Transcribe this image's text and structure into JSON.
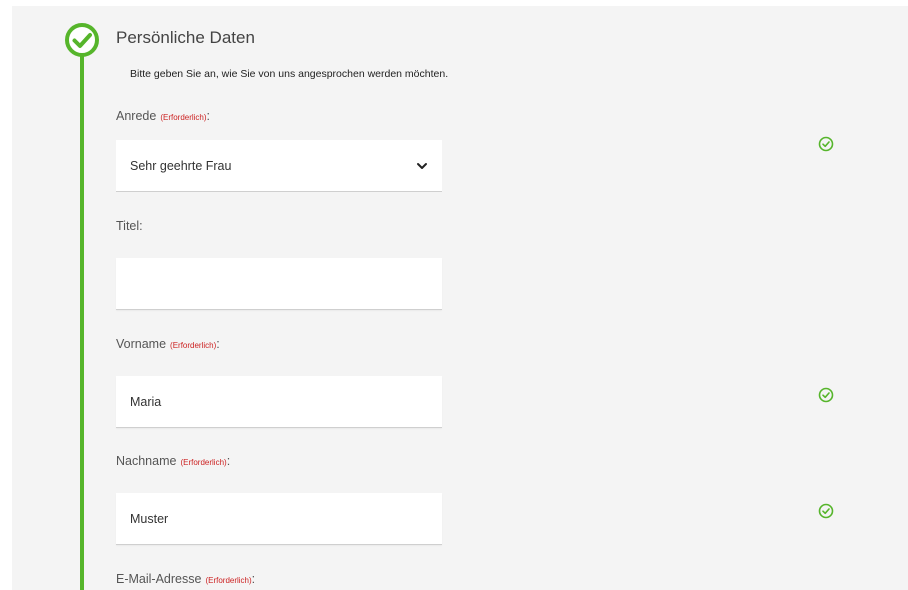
{
  "section": {
    "title": "Persönliche Daten",
    "description": "Bitte geben Sie an, wie Sie von uns angesprochen werden möchten.",
    "step_state": "completed"
  },
  "colors": {
    "accent": "#56b52b",
    "required": "#cc2222"
  },
  "fields": {
    "anrede": {
      "label": "Anrede",
      "required_text": "(Erforderlich)",
      "colon": ":",
      "selected": "Sehr geehrte Frau",
      "icon": "chevron-down-icon",
      "valid": true
    },
    "titel": {
      "label": "Titel:",
      "value": "",
      "placeholder": ""
    },
    "vorname": {
      "label": "Vorname",
      "required_text": "(Erforderlich)",
      "colon": ":",
      "value": "Maria",
      "valid": true
    },
    "nachname": {
      "label": "Nachname",
      "required_text": "(Erforderlich)",
      "colon": ":",
      "value": "Muster",
      "valid": true
    },
    "email": {
      "label": "E-Mail-Adresse",
      "required_text": "(Erforderlich)",
      "colon": ":"
    }
  }
}
